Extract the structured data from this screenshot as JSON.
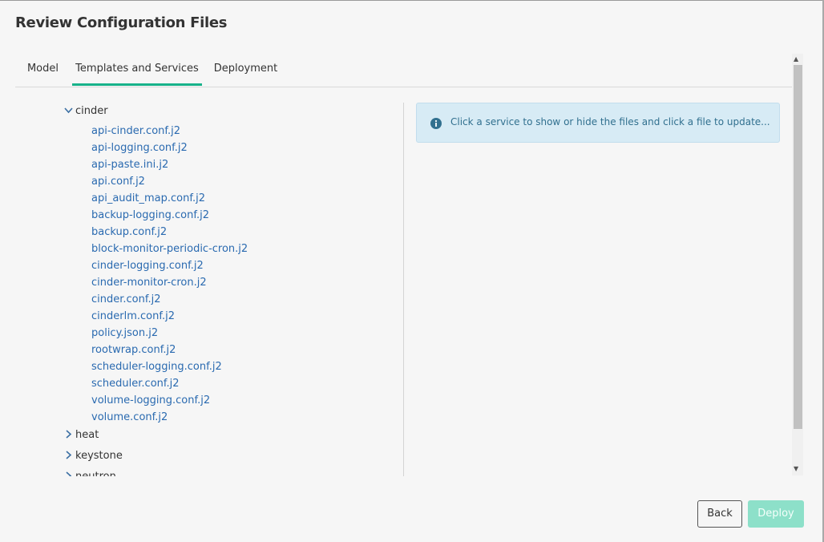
{
  "dialog": {
    "title": "Review Configuration Files"
  },
  "tabs": [
    {
      "label": "Model"
    },
    {
      "label": "Templates and Services"
    },
    {
      "label": "Deployment"
    }
  ],
  "tree": {
    "expanded_service": "cinder",
    "files": [
      "api-cinder.conf.j2",
      "api-logging.conf.j2",
      "api-paste.ini.j2",
      "api.conf.j2",
      "api_audit_map.conf.j2",
      "backup-logging.conf.j2",
      "backup.conf.j2",
      "block-monitor-periodic-cron.j2",
      "cinder-logging.conf.j2",
      "cinder-monitor-cron.j2",
      "cinder.conf.j2",
      "cinderlm.conf.j2",
      "policy.json.j2",
      "rootwrap.conf.j2",
      "scheduler-logging.conf.j2",
      "scheduler.conf.j2",
      "volume-logging.conf.j2",
      "volume.conf.j2"
    ],
    "collapsed_services": [
      "heat",
      "keystone",
      "neutron"
    ]
  },
  "info": {
    "icon": "info-circle-icon",
    "message": "Click a service to show or hide the files and click a file to update..."
  },
  "footer": {
    "back_label": "Back",
    "deploy_label": "Deploy"
  },
  "colors": {
    "accent": "#18b28a",
    "link": "#2a6ab0",
    "info_bg": "#d7ebf5",
    "deploy_disabled": "#8de0c9"
  }
}
